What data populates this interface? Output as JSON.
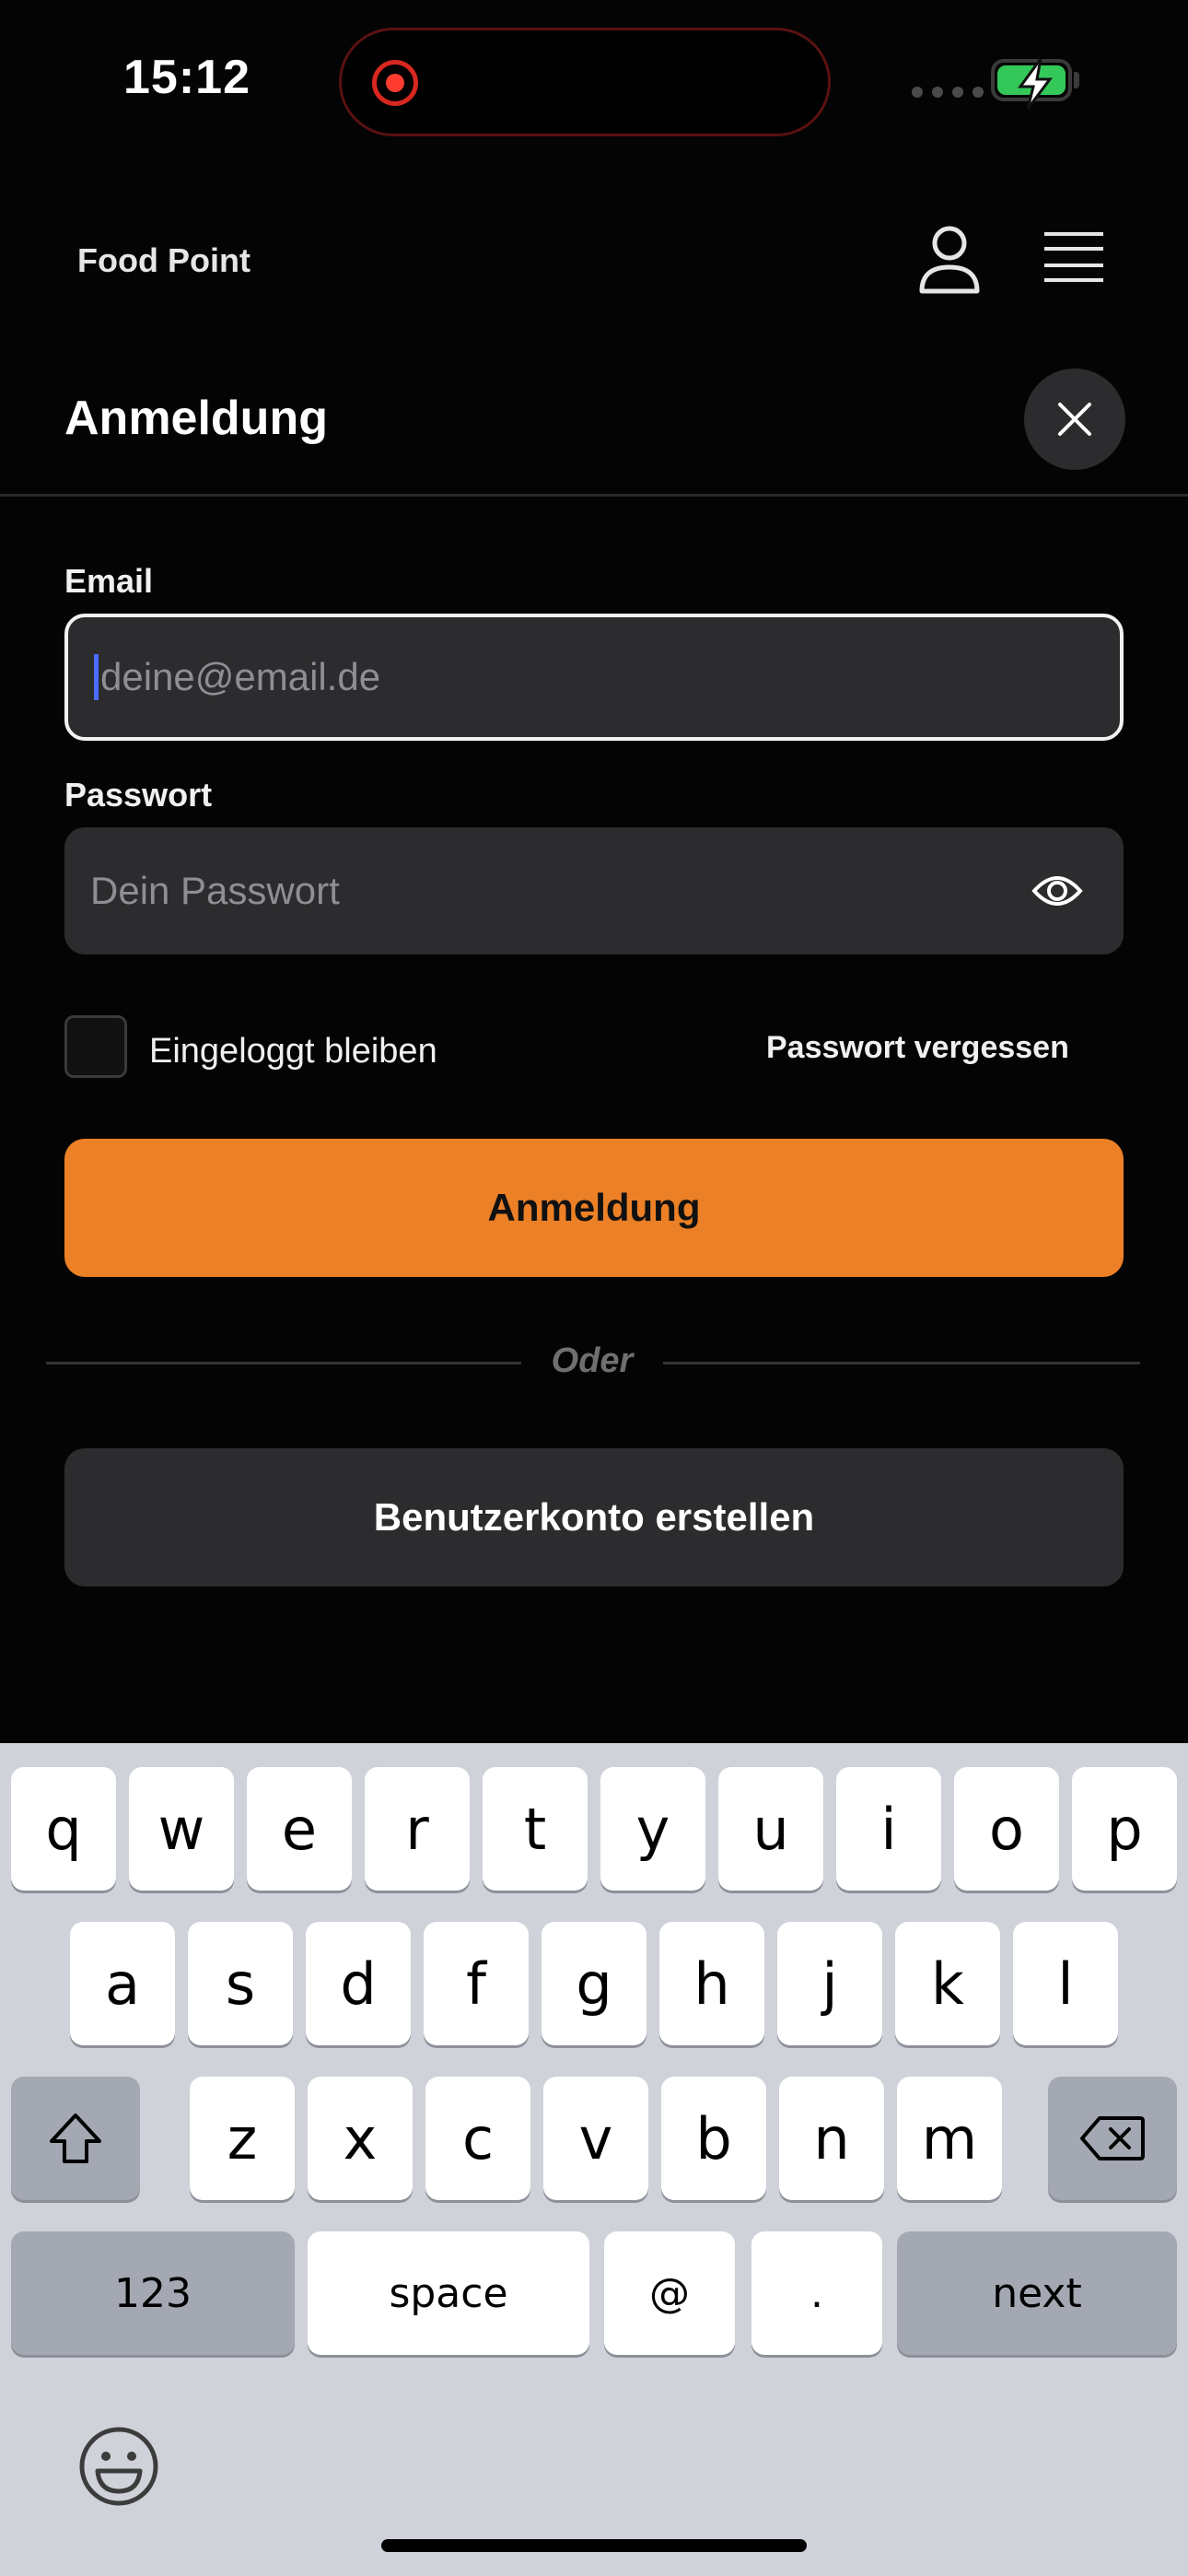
{
  "status": {
    "time": "15:12"
  },
  "header": {
    "brand": "Food Point"
  },
  "sheet": {
    "title": "Anmeldung",
    "email_label": "Email",
    "email_placeholder": "deine@email.de",
    "password_label": "Passwort",
    "password_placeholder": "Dein Passwort",
    "remember_label": "Eingeloggt bleiben",
    "forgot_label": "Passwort vergessen",
    "login_button": "Anmeldung",
    "or_text": "Oder",
    "signup_button": "Benutzerkonto erstellen"
  },
  "colors": {
    "accent": "#ec8026",
    "background": "#040404",
    "field": "#2c2c2e"
  },
  "keyboard": {
    "row1": [
      "q",
      "w",
      "e",
      "r",
      "t",
      "y",
      "u",
      "i",
      "o",
      "p"
    ],
    "row2": [
      "a",
      "s",
      "d",
      "f",
      "g",
      "h",
      "j",
      "k",
      "l"
    ],
    "row3": [
      "z",
      "x",
      "c",
      "v",
      "b",
      "n",
      "m"
    ],
    "numbers_key": "123",
    "space_key": "space",
    "at_key": "@",
    "dot_key": ".",
    "next_key": "next",
    "icons": [
      "shift-icon",
      "delete-icon",
      "emoji-icon"
    ]
  }
}
